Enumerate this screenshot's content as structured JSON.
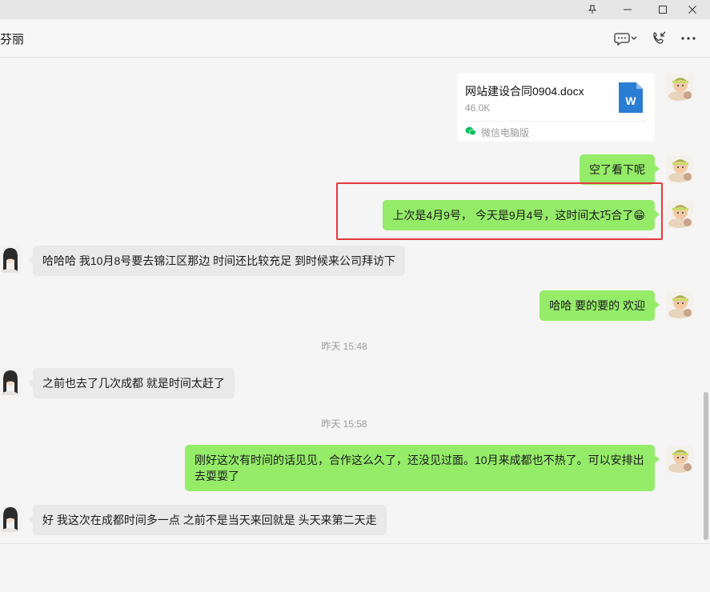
{
  "window": {
    "pin_icon": "pin-icon",
    "minimize_icon": "minimize-icon",
    "maximize_icon": "maximize-icon",
    "close_icon": "close-icon"
  },
  "header": {
    "title": "芬丽",
    "chat_menu_icon": "chat-bubble-icon",
    "call_icon": "phone-call-icon",
    "more_icon": "more-icon"
  },
  "file_message": {
    "name": "网站建设合同0904.docx",
    "size": "46.0K",
    "source": "微信电脑版",
    "file_icon": "word-document-icon",
    "file_icon_letter": "W"
  },
  "messages": {
    "m1": "空了看下呢",
    "m2": "上次是4月9号， 今天是9月4号，这时间太巧合了😁",
    "m3": "哈哈哈 我10月8号要去锦江区那边 时间还比较充足 到时候来公司拜访下",
    "m4": "哈哈 要的要的 欢迎",
    "m5": "之前也去了几次成都 就是时间太赶了",
    "m6": "刚好这次有时间的话见见，合作这么久了，还没见过面。10月来成都也不热了。可以安排出去耍耍了",
    "m7": "好 我这次在成都时间多一点 之前不是当天来回就是 头天来第二天走"
  },
  "timestamps": {
    "t1": "昨天 15:48",
    "t2": "昨天 15:58"
  },
  "colors": {
    "my_bubble": "#95ec69",
    "other_bubble": "#e9e9e9",
    "highlight": "#e6393c",
    "word_blue": "#2b7cd3"
  }
}
